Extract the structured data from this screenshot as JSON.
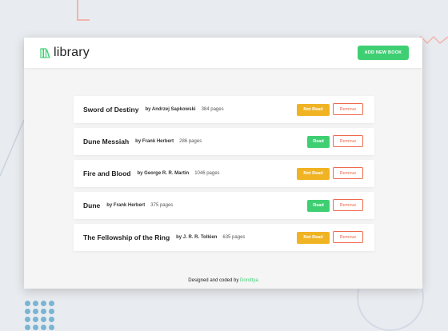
{
  "app": {
    "logo_text": "library",
    "add_button": "ADD NEW BOOK"
  },
  "books": [
    {
      "title": "Sword of Destiny",
      "author": "by Andrzej Sapkowski",
      "pages": "384 pages",
      "status": "Not Read",
      "remove": "Remove"
    },
    {
      "title": "Dune Messiah",
      "author": "by Frank Herbert",
      "pages": "286 pages",
      "status": "Read",
      "remove": "Remove"
    },
    {
      "title": "Fire and Blood",
      "author": "by George R. R. Martin",
      "pages": "1046 pages",
      "status": "Not Read",
      "remove": "Remove"
    },
    {
      "title": "Dune",
      "author": "by Frank Herbert",
      "pages": "375 pages",
      "status": "Read",
      "remove": "Remove"
    },
    {
      "title": "The Fellowship of the Ring",
      "author": "by J. R. R. Tolkien",
      "pages": "635 pages",
      "status": "Not Read",
      "remove": "Remove"
    }
  ],
  "footer": {
    "text": "Designed and coded by ",
    "author_link": "Dorottya"
  },
  "colors": {
    "read": "#3ecf73",
    "not_read": "#f0b323",
    "remove": "#ef6a4e",
    "background": "#e8ebef"
  }
}
